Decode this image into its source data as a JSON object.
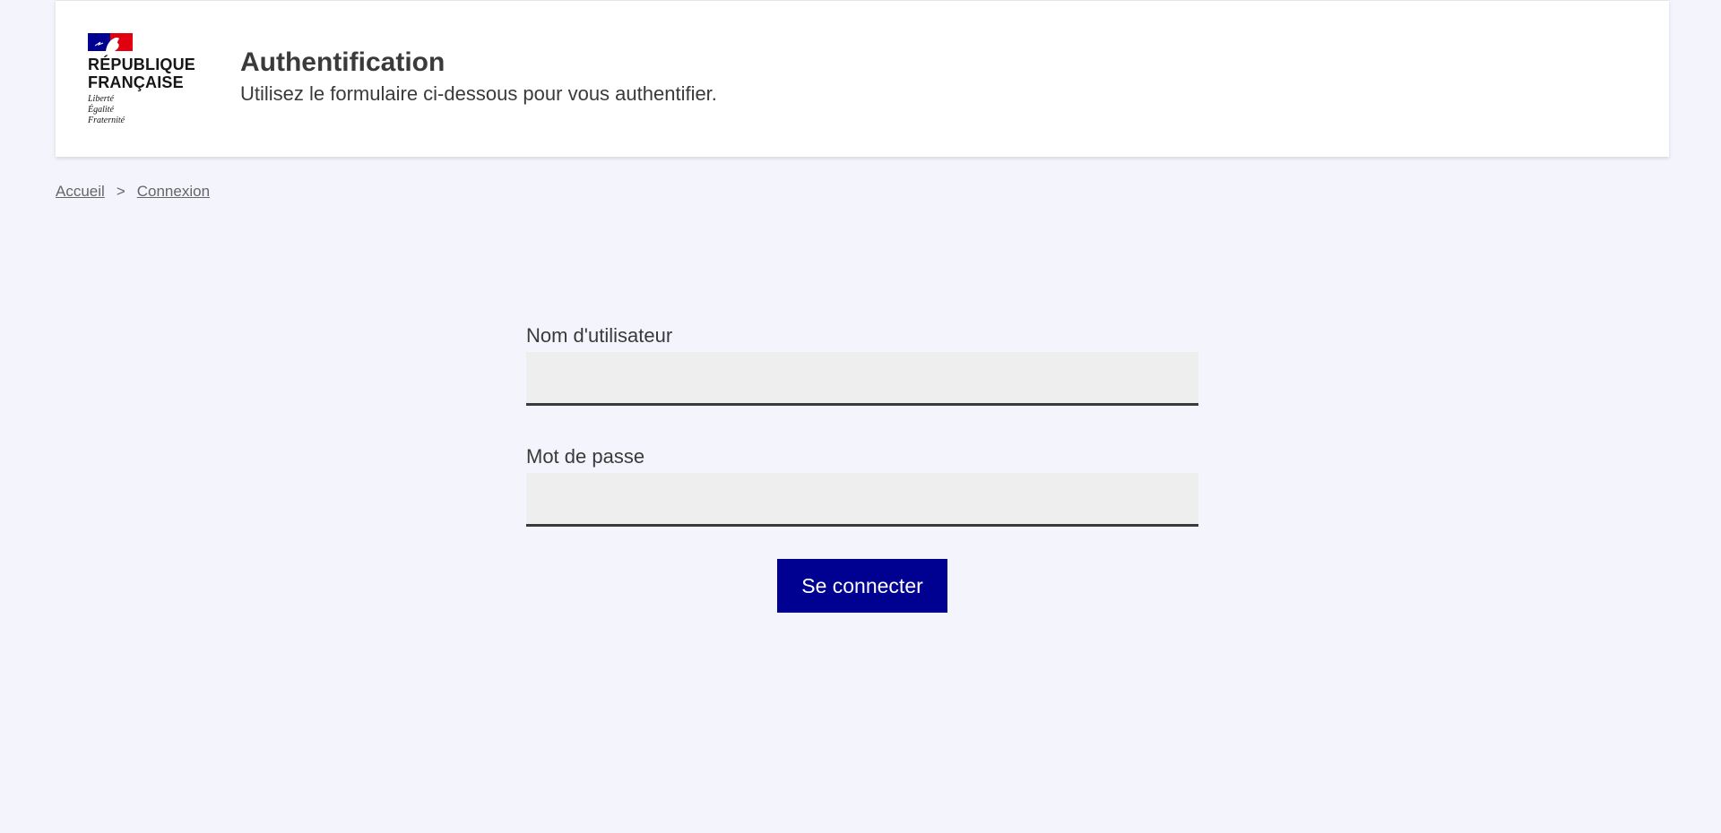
{
  "header": {
    "logo": {
      "name": "RÉPUBLIQUE\nFRANÇAISE",
      "motto": [
        "Liberté",
        "Égalité",
        "Fraternité"
      ],
      "colors": {
        "blue": "#000091",
        "red": "#e1000f"
      }
    },
    "title": "Authentification",
    "subtitle": "Utilisez le formulaire ci-dessous pour vous authentifier."
  },
  "breadcrumb": {
    "items": [
      "Accueil",
      "Connexion"
    ],
    "separator": ">"
  },
  "form": {
    "username": {
      "label": "Nom d'utilisateur",
      "value": "",
      "placeholder": ""
    },
    "password": {
      "label": "Mot de passe",
      "value": "",
      "placeholder": ""
    },
    "submit_label": "Se connecter"
  },
  "colors": {
    "background": "#f4f4fd",
    "accent": "#000091"
  }
}
